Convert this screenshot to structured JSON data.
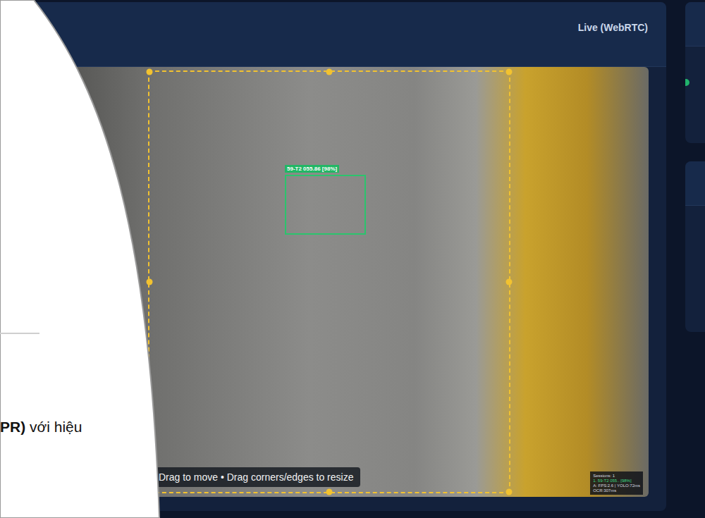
{
  "header": {
    "title": "Live (WebRTC)"
  },
  "video": {
    "roi_hint": "Drag to move • Drag corners/edges to resize",
    "detections": [
      {
        "label": "59-T2 055.86 [98%]"
      }
    ],
    "stats": [
      {
        "text": "Sessions: 1",
        "kind": "plain"
      },
      {
        "text": "1. 59-T2 055.. [98%]",
        "kind": "session"
      },
      {
        "text": "A: FPS:2.6 | YOLO:72ms",
        "kind": "plain"
      },
      {
        "text": "OCR:307ms",
        "kind": "plain"
      }
    ]
  },
  "slide": {
    "text_bold": "PR)",
    "text": " với hiệu"
  },
  "side_panels": [
    {
      "status_on": true
    },
    {
      "status_on": false
    }
  ]
}
